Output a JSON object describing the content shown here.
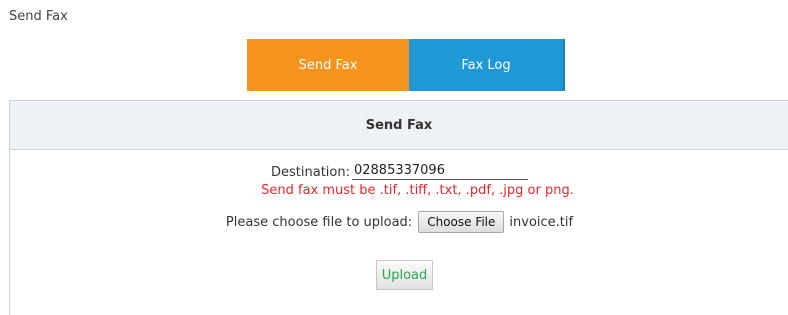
{
  "page": {
    "title": "Send Fax"
  },
  "tabs": [
    {
      "label": "Send Fax",
      "active": true,
      "color": "#f7941d"
    },
    {
      "label": "Fax Log",
      "active": false,
      "color": "#1f98d6"
    }
  ],
  "panel": {
    "header": "Send Fax",
    "destination_label": "Destination:",
    "destination_value": "02885337096",
    "note": "Send fax must be .tif, .tiff, .txt, .pdf, .jpg or png.",
    "file_label": "Please choose file to upload:",
    "choose_button": "Choose File",
    "file_name": "invoice.tif",
    "upload_button": "Upload"
  },
  "colors": {
    "note": "#e8262b",
    "upload_text": "#2aa64c",
    "header_bg": "#eef2f7"
  }
}
